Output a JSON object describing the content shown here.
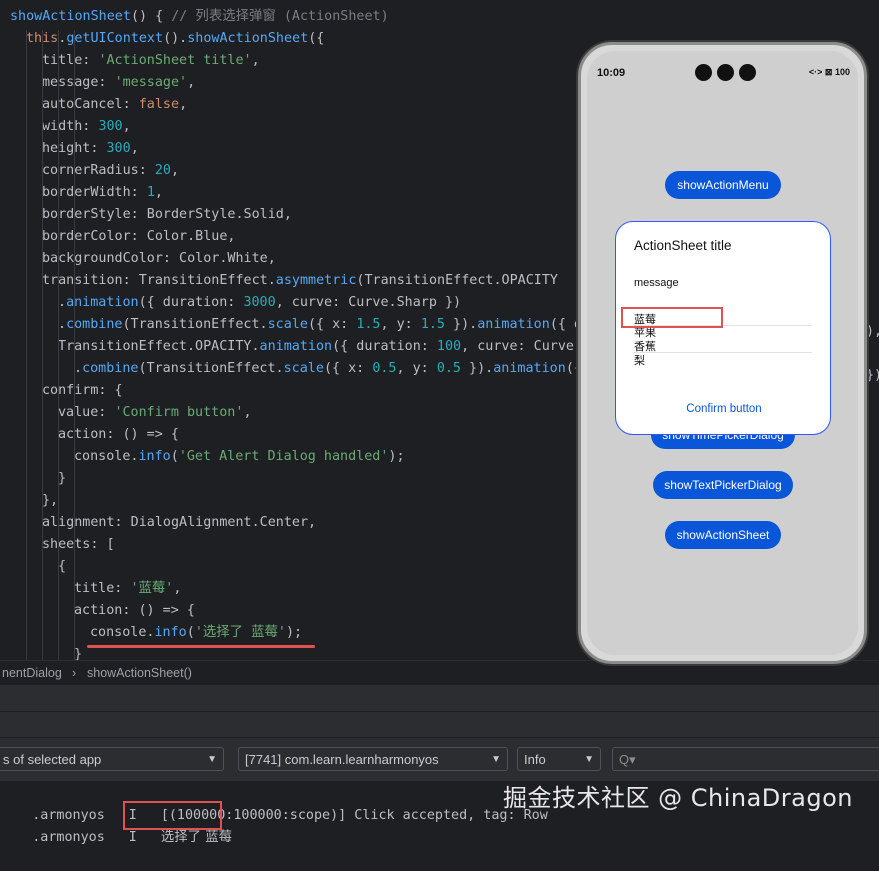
{
  "code": [
    {
      "indent": 0,
      "tokens": [
        [
          "fn",
          "showActionSheet"
        ],
        [
          "cls",
          "() { "
        ],
        [
          "cm",
          "// 列表选择弹窗 (ActionSheet)"
        ]
      ]
    },
    {
      "indent": 1,
      "tokens": [
        [
          "kw",
          "this"
        ],
        [
          "cls",
          "."
        ],
        [
          "fn",
          "getUIContext"
        ],
        [
          "cls",
          "()."
        ],
        [
          "fn",
          "showActionSheet"
        ],
        [
          "cls",
          "({"
        ]
      ]
    },
    {
      "indent": 2,
      "tokens": [
        [
          "cls",
          "title: "
        ],
        [
          "str",
          "'ActionSheet title'"
        ],
        [
          "cls",
          ","
        ]
      ]
    },
    {
      "indent": 2,
      "tokens": [
        [
          "cls",
          "message: "
        ],
        [
          "str",
          "'message'"
        ],
        [
          "cls",
          ","
        ]
      ]
    },
    {
      "indent": 2,
      "tokens": [
        [
          "cls",
          "autoCancel: "
        ],
        [
          "kw",
          "false"
        ],
        [
          "cls",
          ","
        ]
      ]
    },
    {
      "indent": 2,
      "tokens": [
        [
          "cls",
          "width: "
        ],
        [
          "num",
          "300"
        ],
        [
          "cls",
          ","
        ]
      ]
    },
    {
      "indent": 2,
      "tokens": [
        [
          "cls",
          "height: "
        ],
        [
          "num",
          "300"
        ],
        [
          "cls",
          ","
        ]
      ]
    },
    {
      "indent": 2,
      "tokens": [
        [
          "cls",
          "cornerRadius: "
        ],
        [
          "num",
          "20"
        ],
        [
          "cls",
          ","
        ]
      ]
    },
    {
      "indent": 2,
      "tokens": [
        [
          "cls",
          "borderWidth: "
        ],
        [
          "num",
          "1"
        ],
        [
          "cls",
          ","
        ]
      ]
    },
    {
      "indent": 2,
      "tokens": [
        [
          "cls",
          "borderStyle: BorderStyle.Solid,"
        ]
      ]
    },
    {
      "indent": 2,
      "tokens": [
        [
          "cls",
          "borderColor: Color.Blue,"
        ]
      ]
    },
    {
      "indent": 2,
      "tokens": [
        [
          "cls",
          "backgroundColor: Color.White,"
        ]
      ]
    },
    {
      "indent": 2,
      "tokens": [
        [
          "cls",
          "transition: TransitionEffect."
        ],
        [
          "fn",
          "asymmetric"
        ],
        [
          "cls",
          "(TransitionEffect.OPACITY"
        ]
      ]
    },
    {
      "indent": 3,
      "tokens": [
        [
          "cls",
          "."
        ],
        [
          "fn",
          "animation"
        ],
        [
          "cls",
          "({ duration: "
        ],
        [
          "num",
          "3000"
        ],
        [
          "cls",
          ", curve: Curve.Sharp })"
        ]
      ]
    },
    {
      "indent": 3,
      "tokens": [
        [
          "cls",
          "."
        ],
        [
          "fn",
          "combine"
        ],
        [
          "cls",
          "(TransitionEffect."
        ],
        [
          "fn",
          "scale"
        ],
        [
          "cls",
          "({ x: "
        ],
        [
          "num",
          "1.5"
        ],
        [
          "cls",
          ", y: "
        ],
        [
          "num",
          "1.5"
        ],
        [
          "cls",
          " })."
        ],
        [
          "fn",
          "animation"
        ],
        [
          "cls",
          "({ d"
        ]
      ]
    },
    {
      "indent": 3,
      "tokens": [
        [
          "cls",
          "TransitionEffect.OPACITY."
        ],
        [
          "fn",
          "animation"
        ],
        [
          "cls",
          "({ duration: "
        ],
        [
          "num",
          "100"
        ],
        [
          "cls",
          ", curve: Curve."
        ]
      ]
    },
    {
      "indent": 4,
      "tokens": [
        [
          "cls",
          "."
        ],
        [
          "fn",
          "combine"
        ],
        [
          "cls",
          "(TransitionEffect."
        ],
        [
          "fn",
          "scale"
        ],
        [
          "cls",
          "({ x: "
        ],
        [
          "num",
          "0.5"
        ],
        [
          "cls",
          ", y: "
        ],
        [
          "num",
          "0.5"
        ],
        [
          "cls",
          " })."
        ],
        [
          "fn",
          "animation"
        ],
        [
          "cls",
          "({"
        ]
      ]
    },
    {
      "indent": 2,
      "tokens": [
        [
          "cls",
          "confirm: {"
        ]
      ]
    },
    {
      "indent": 3,
      "tokens": [
        [
          "cls",
          "value: "
        ],
        [
          "str",
          "'Confirm button'"
        ],
        [
          "cls",
          ","
        ]
      ]
    },
    {
      "indent": 3,
      "tokens": [
        [
          "cls",
          "action: () => {"
        ]
      ]
    },
    {
      "indent": 4,
      "tokens": [
        [
          "cls",
          "console."
        ],
        [
          "fn",
          "info"
        ],
        [
          "cls",
          "("
        ],
        [
          "str",
          "'Get Alert Dialog handled'"
        ],
        [
          "cls",
          ");"
        ]
      ]
    },
    {
      "indent": 3,
      "tokens": [
        [
          "cls",
          "}"
        ]
      ]
    },
    {
      "indent": 2,
      "tokens": [
        [
          "cls",
          "},"
        ]
      ]
    },
    {
      "indent": 2,
      "tokens": [
        [
          "cls",
          "alignment: DialogAlignment.Center,"
        ]
      ]
    },
    {
      "indent": 2,
      "tokens": [
        [
          "cls",
          "sheets: ["
        ]
      ]
    },
    {
      "indent": 3,
      "tokens": [
        [
          "cls",
          "{"
        ]
      ]
    },
    {
      "indent": 4,
      "tokens": [
        [
          "cls",
          "title: "
        ],
        [
          "str",
          "'蓝莓'"
        ],
        [
          "cls",
          ","
        ]
      ]
    },
    {
      "indent": 4,
      "tokens": [
        [
          "cls",
          "action: () => {"
        ]
      ]
    },
    {
      "indent": 5,
      "tokens": [
        [
          "cls",
          "console."
        ],
        [
          "fn",
          "info"
        ],
        [
          "cls",
          "("
        ],
        [
          "str",
          "'选择了 蓝莓'"
        ],
        [
          "cls",
          ");"
        ]
      ]
    },
    {
      "indent": 4,
      "tokens": [
        [
          "cls",
          "}"
        ]
      ]
    }
  ],
  "right_edge_fragments": [
    "),",
    "})"
  ],
  "breadcrumb": {
    "item1": "nentDialog",
    "sep": "›",
    "item2": "showActionSheet()"
  },
  "log_toolbar": {
    "device_filter": "s of selected app",
    "process_filter": "[7741] com.learn.learnharmonyos",
    "level": "Info",
    "search_placeholder": "Q▾"
  },
  "logs": [
    {
      "tag": ".armonyos",
      "level": "I",
      "text": "[(100000:100000:scope)] Click accepted, tag: Row"
    },
    {
      "tag": ".armonyos",
      "level": "I",
      "text": "选择了 蓝莓"
    }
  ],
  "phone": {
    "time": "10:09",
    "status_right": "<·> ⊠ 100",
    "buttons": {
      "action_menu": "showActionMenu",
      "time_picker": "showTimePickerDialog",
      "text_picker": "showTextPickerDialog",
      "action_sheet": "showActionSheet"
    },
    "sheet": {
      "title": "ActionSheet title",
      "message": "message",
      "items": [
        "蓝莓",
        "苹果",
        "香蕉",
        "梨"
      ],
      "confirm": "Confirm button"
    }
  },
  "watermark": "掘金技术社区 @ ChinaDragon",
  "colors": {
    "accent": "#0a56d8",
    "highlight": "#e05252",
    "editor_bg": "#1e1f22"
  }
}
